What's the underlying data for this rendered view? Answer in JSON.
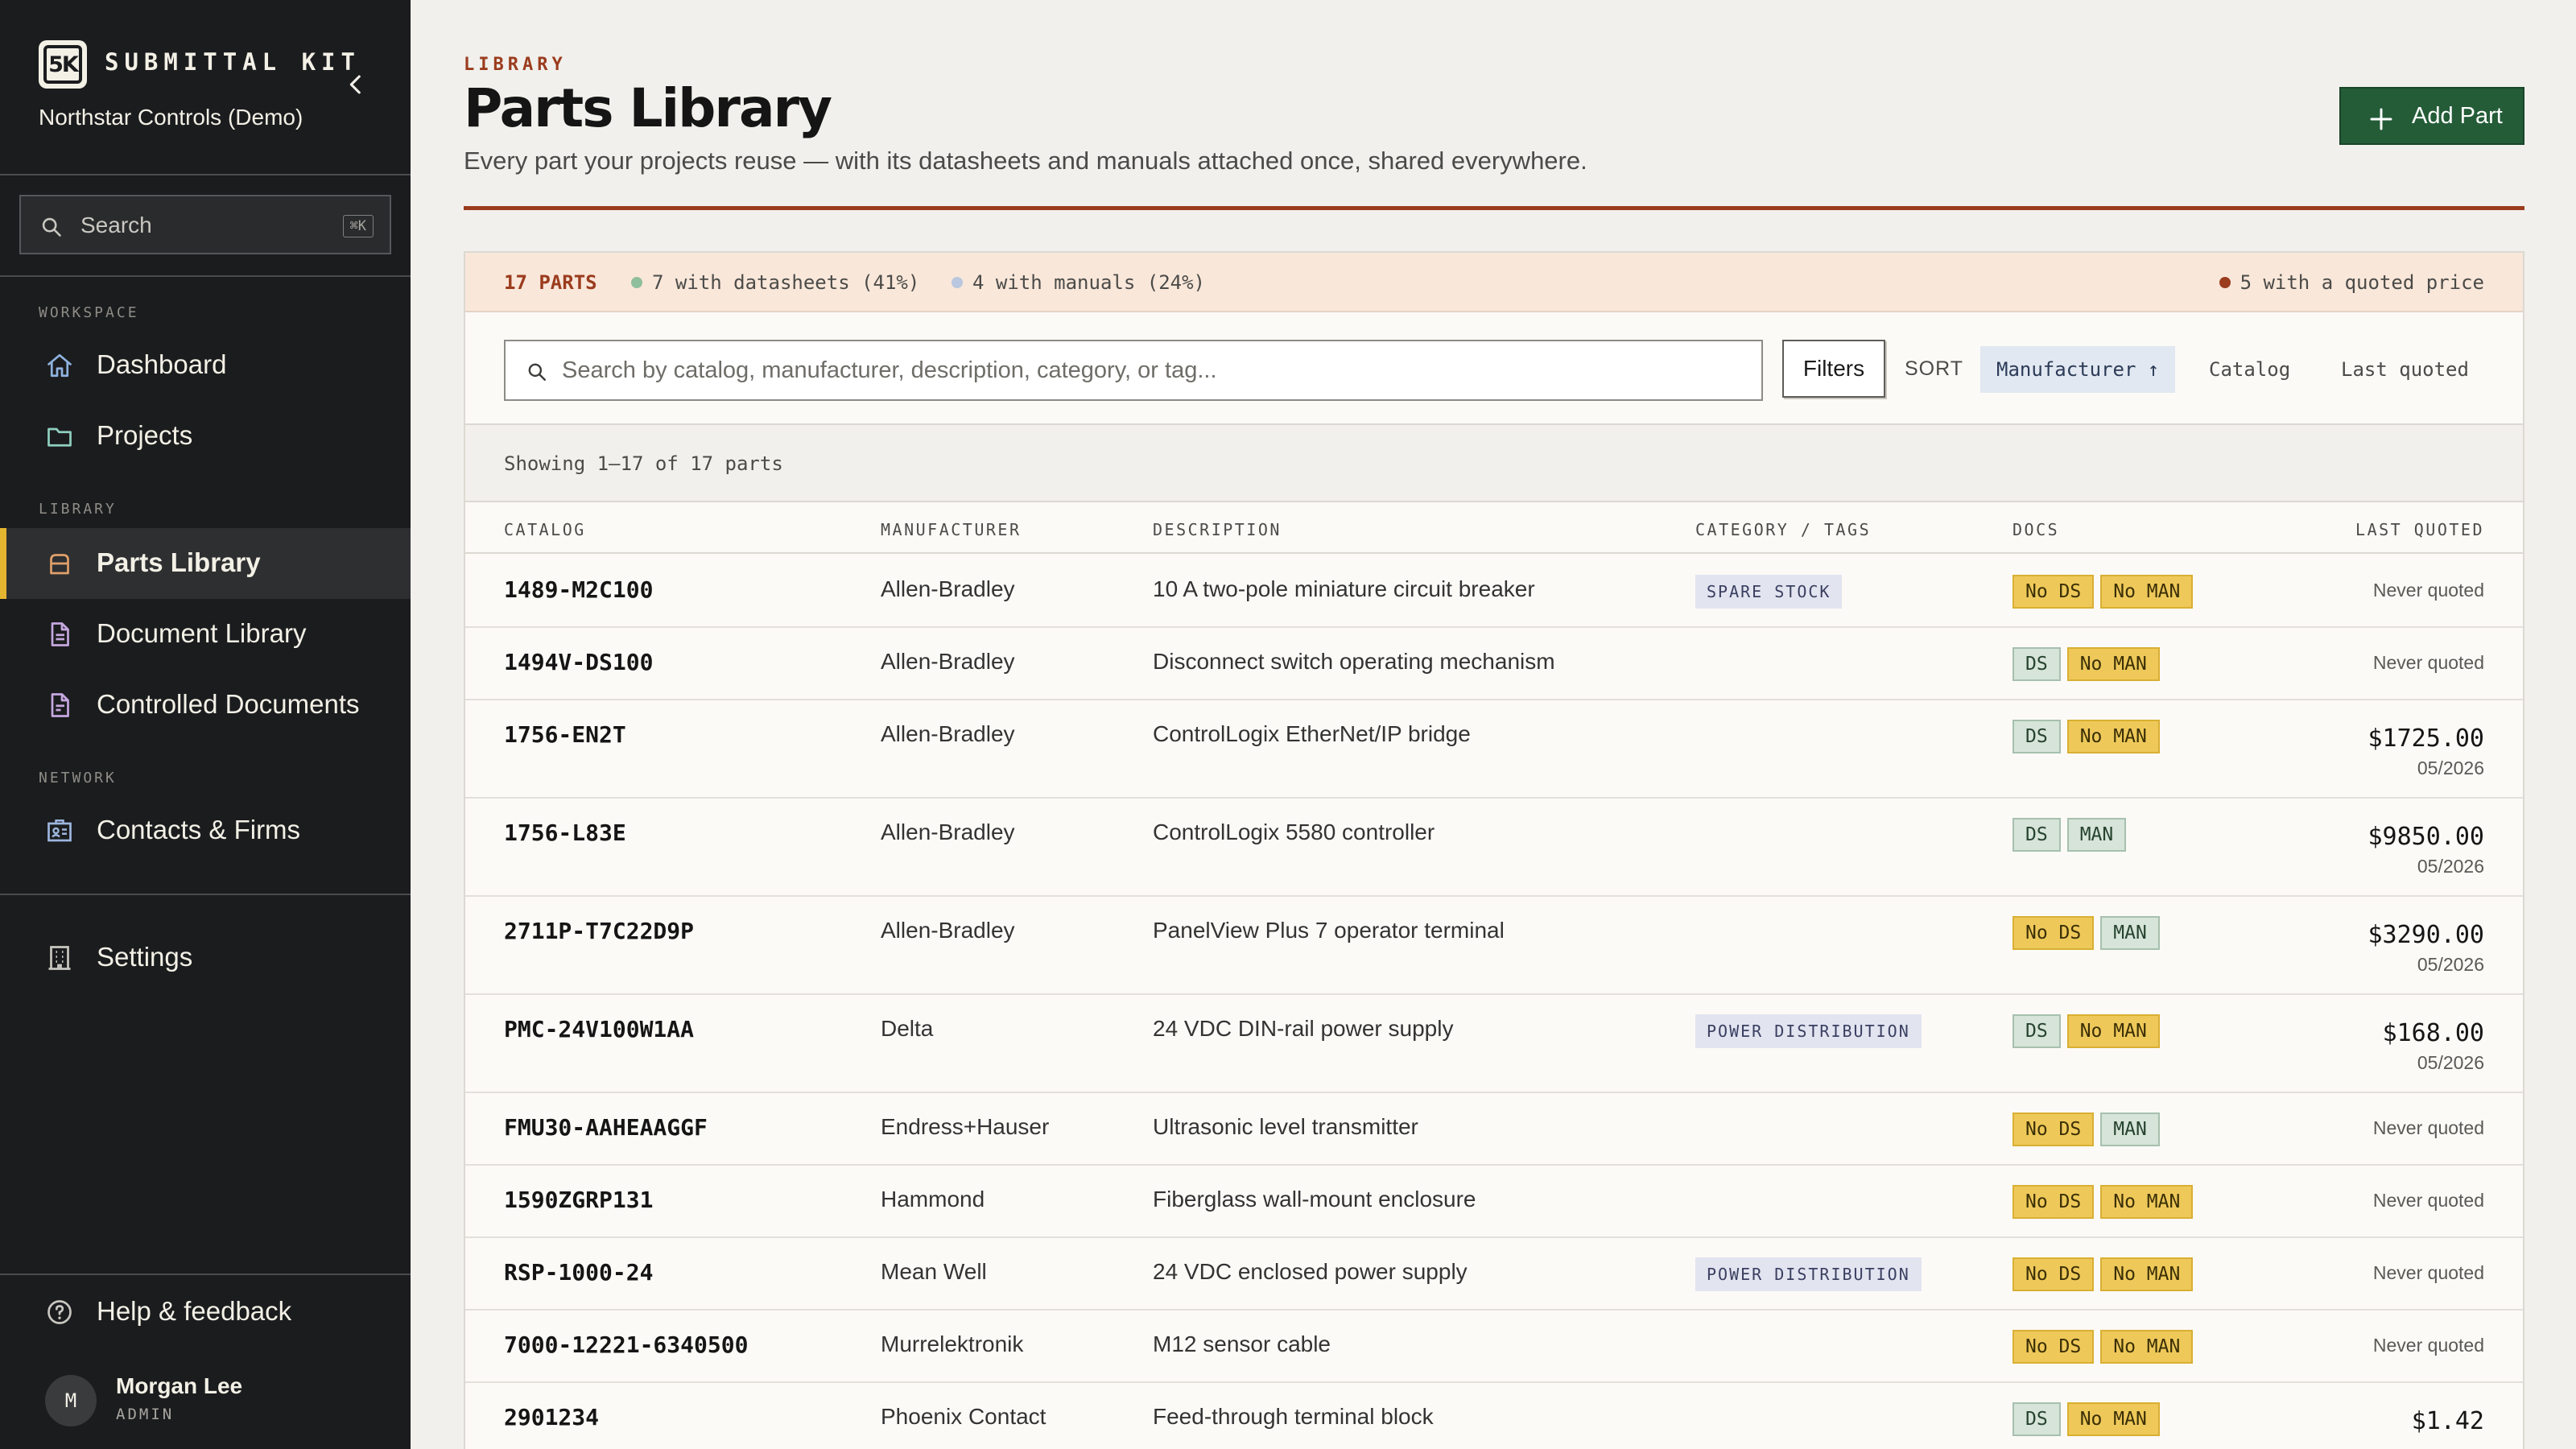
{
  "app": {
    "brand_logo": "5K",
    "brand_name": "SUBMITTAL KIT",
    "org": "Northstar Controls (Demo)"
  },
  "sidebar": {
    "search_label": "Search",
    "search_shortcut": "⌘K",
    "sections": {
      "workspace": "WORKSPACE",
      "library": "LIBRARY",
      "network": "NETWORK"
    },
    "items": [
      {
        "label": "Dashboard",
        "icon": "home-icon"
      },
      {
        "label": "Projects",
        "icon": "folder-icon"
      },
      {
        "label": "Parts Library",
        "icon": "box-icon",
        "active": true
      },
      {
        "label": "Document Library",
        "icon": "document-icon"
      },
      {
        "label": "Controlled Documents",
        "icon": "controlled-document-icon"
      },
      {
        "label": "Contacts & Firms",
        "icon": "contact-card-icon"
      },
      {
        "label": "Settings",
        "icon": "building-icon"
      },
      {
        "label": "Help & feedback",
        "icon": "help-icon"
      }
    ],
    "user": {
      "initial": "M",
      "name": "Morgan Lee",
      "role": "ADMIN"
    }
  },
  "header": {
    "eyebrow": "LIBRARY",
    "title": "Parts Library",
    "subtitle": "Every part your projects reuse — with its datasheets and manuals attached once, shared everywhere.",
    "add_button": "Add Part"
  },
  "stats": {
    "count": "17 PARTS",
    "datasheets": "7 with datasheets (41%)",
    "manuals": "4 with manuals (24%)",
    "quoted": "5 with a quoted price"
  },
  "toolbar": {
    "search_placeholder": "Search by catalog, manufacturer, description, category, or tag...",
    "filters": "Filters",
    "sort_label": "SORT",
    "sort_options": [
      "Manufacturer ↑",
      "Catalog",
      "Last quoted"
    ],
    "showing": "Showing 1–17 of 17 parts"
  },
  "table": {
    "columns": [
      "CATALOG",
      "MANUFACTURER",
      "DESCRIPTION",
      "CATEGORY / TAGS",
      "DOCS",
      "LAST QUOTED"
    ],
    "rows": [
      {
        "catalog": "1489-M2C100",
        "manufacturer": "Allen-Bradley",
        "description": "10 A two-pole miniature circuit breaker",
        "tag": "SPARE STOCK",
        "ds": "No DS",
        "man": "No MAN",
        "price": "",
        "date": "",
        "never": "Never quoted"
      },
      {
        "catalog": "1494V-DS100",
        "manufacturer": "Allen-Bradley",
        "description": "Disconnect switch operating mechanism",
        "tag": "",
        "ds": "DS",
        "man": "No MAN",
        "price": "",
        "date": "",
        "never": "Never quoted"
      },
      {
        "catalog": "1756-EN2T",
        "manufacturer": "Allen-Bradley",
        "description": "ControlLogix EtherNet/IP bridge",
        "tag": "",
        "ds": "DS",
        "man": "No MAN",
        "price": "$1725.00",
        "date": "05/2026",
        "never": ""
      },
      {
        "catalog": "1756-L83E",
        "manufacturer": "Allen-Bradley",
        "description": "ControlLogix 5580 controller",
        "tag": "",
        "ds": "DS",
        "man": "MAN",
        "price": "$9850.00",
        "date": "05/2026",
        "never": ""
      },
      {
        "catalog": "2711P-T7C22D9P",
        "manufacturer": "Allen-Bradley",
        "description": "PanelView Plus 7 operator terminal",
        "tag": "",
        "ds": "No DS",
        "man": "MAN",
        "price": "$3290.00",
        "date": "05/2026",
        "never": ""
      },
      {
        "catalog": "PMC-24V100W1AA",
        "manufacturer": "Delta",
        "description": "24 VDC DIN-rail power supply",
        "tag": "POWER DISTRIBUTION",
        "ds": "DS",
        "man": "No MAN",
        "price": "$168.00",
        "date": "05/2026",
        "never": ""
      },
      {
        "catalog": "FMU30-AAHEAAGGF",
        "manufacturer": "Endress+Hauser",
        "description": "Ultrasonic level transmitter",
        "tag": "",
        "ds": "No DS",
        "man": "MAN",
        "price": "",
        "date": "",
        "never": "Never quoted"
      },
      {
        "catalog": "1590ZGRP131",
        "manufacturer": "Hammond",
        "description": "Fiberglass wall-mount enclosure",
        "tag": "",
        "ds": "No DS",
        "man": "No MAN",
        "price": "",
        "date": "",
        "never": "Never quoted"
      },
      {
        "catalog": "RSP-1000-24",
        "manufacturer": "Mean Well",
        "description": "24 VDC enclosed power supply",
        "tag": "POWER DISTRIBUTION",
        "ds": "No DS",
        "man": "No MAN",
        "price": "",
        "date": "",
        "never": "Never quoted"
      },
      {
        "catalog": "7000-12221-6340500",
        "manufacturer": "Murrelektronik",
        "description": "M12 sensor cable",
        "tag": "",
        "ds": "No DS",
        "man": "No MAN",
        "price": "",
        "date": "",
        "never": "Never quoted"
      },
      {
        "catalog": "2901234",
        "manufacturer": "Phoenix Contact",
        "description": "Feed-through terminal block",
        "tag": "",
        "ds": "DS",
        "man": "No MAN",
        "price": "$1.42",
        "date": "",
        "never": ""
      }
    ]
  },
  "colors": {
    "accent_rust": "#9b3c1e",
    "accent_gold": "#e4b52f",
    "primary_green": "#245c38",
    "sidebar_bg": "#1b1c1e",
    "datasheet_dot": "#8fbf9c",
    "manual_dot": "#b9c7df",
    "quoted_dot": "#9b3c1e"
  }
}
